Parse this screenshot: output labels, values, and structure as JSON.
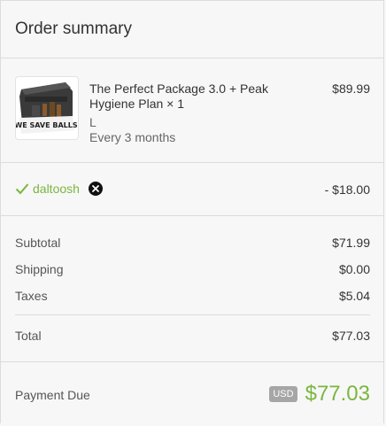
{
  "header": {
    "title": "Order summary"
  },
  "product": {
    "name": "The Perfect Package 3.0 + Peak Hygiene Plan × 1",
    "size": "L",
    "frequency": "Every 3 months",
    "price": "$89.99",
    "image_text": "WE SAVE BALLS",
    "image_icon": "product-box-icon"
  },
  "discount": {
    "code": "daltoosh",
    "amount": "- $18.00",
    "check_icon": "check-icon",
    "remove_icon": "close-circle-icon"
  },
  "totals": {
    "subtotal_label": "Subtotal",
    "subtotal_value": "$71.99",
    "shipping_label": "Shipping",
    "shipping_value": "$0.00",
    "taxes_label": "Taxes",
    "taxes_value": "$5.04",
    "total_label": "Total",
    "total_value": "$77.03"
  },
  "payment_due": {
    "label": "Payment Due",
    "currency": "USD",
    "amount": "$77.03"
  },
  "colors": {
    "accent": "#7ab63f",
    "text": "#333333",
    "muted": "#555555",
    "border": "#dcdcdc",
    "badge": "#a6a6a6"
  }
}
